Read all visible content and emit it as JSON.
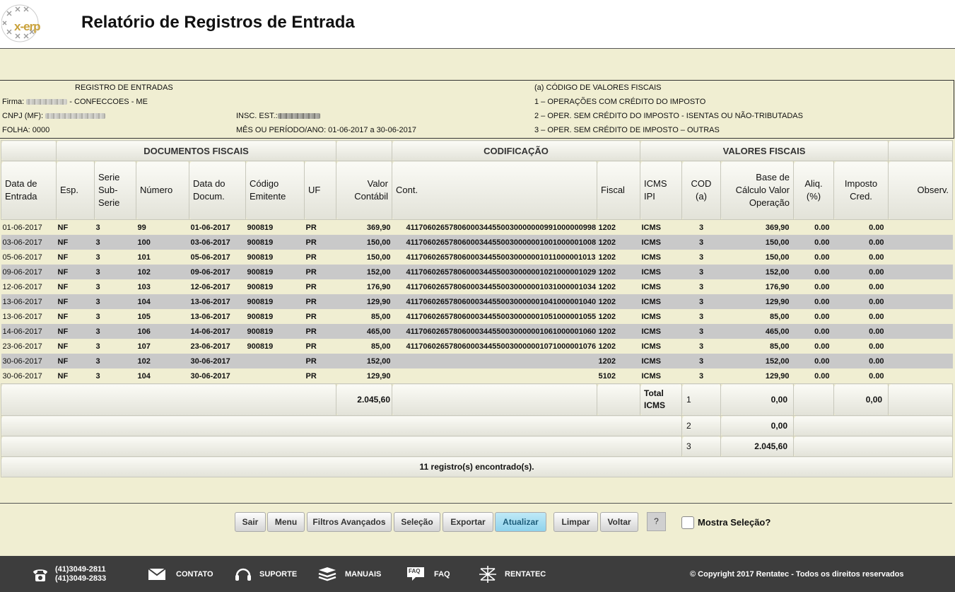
{
  "header": {
    "logo_text": "x-erp",
    "title": "Relatório de Registros de Entrada"
  },
  "info": {
    "registro_title": "REGISTRO DE ENTRADAS",
    "firma_label": "Firma:",
    "firma_suffix": "- CONFECCOES - ME",
    "cnpj_label": "CNPJ (MF):",
    "folha": "FOLHA: 0000",
    "insc_label": "INSC. EST.:",
    "periodo": "MÊS OU PERÍODO/ANO: 01-06-2017 a 30-06-2017",
    "codigo_title": "(a) CÓDIGO DE VALORES FISCAIS",
    "codigo_1": "1 – OPERAÇÕES COM CRÉDITO DO IMPOSTO",
    "codigo_2": "2 – OPER. SEM CRÉDITO DO IMPOSTO - ISENTAS OU NÃO-TRIBUTADAS",
    "codigo_3": "3 – OPER. SEM CRÉDITO DE IMPOSTO – OUTRAS"
  },
  "groups": {
    "documentos": "DOCUMENTOS FISCAIS",
    "codificacao": "CODIFICAÇÃO",
    "valores": "VALORES FISCAIS"
  },
  "columns": [
    "Data de Entrada",
    "Esp.",
    "Serie Sub-Serie",
    "Número",
    "Data do Docum.",
    "Código Emitente",
    "UF",
    "Valor Contábil",
    "Cont.",
    "Fiscal",
    "ICMS IPI",
    "COD (a)",
    "Base de Cálculo Valor Operação",
    "Aliq. (%)",
    "Imposto Cred.",
    "Observ."
  ],
  "rows": [
    [
      "01-06-2017",
      "NF",
      "3",
      "99",
      "01-06-2017",
      "900819",
      "PR",
      "369,90",
      "41170602657806000344550030000000991000000998",
      "1202",
      "ICMS",
      "3",
      "369,90",
      "0.00",
      "0.00",
      ""
    ],
    [
      "03-06-2017",
      "NF",
      "3",
      "100",
      "03-06-2017",
      "900819",
      "PR",
      "150,00",
      "41170602657806000344550030000001001000001008",
      "1202",
      "ICMS",
      "3",
      "150,00",
      "0.00",
      "0.00",
      ""
    ],
    [
      "05-06-2017",
      "NF",
      "3",
      "101",
      "05-06-2017",
      "900819",
      "PR",
      "150,00",
      "41170602657806000344550030000001011000001013",
      "1202",
      "ICMS",
      "3",
      "150,00",
      "0.00",
      "0.00",
      ""
    ],
    [
      "09-06-2017",
      "NF",
      "3",
      "102",
      "09-06-2017",
      "900819",
      "PR",
      "152,00",
      "41170602657806000344550030000001021000001029",
      "1202",
      "ICMS",
      "3",
      "152,00",
      "0.00",
      "0.00",
      ""
    ],
    [
      "12-06-2017",
      "NF",
      "3",
      "103",
      "12-06-2017",
      "900819",
      "PR",
      "176,90",
      "41170602657806000344550030000001031000001034",
      "1202",
      "ICMS",
      "3",
      "176,90",
      "0.00",
      "0.00",
      ""
    ],
    [
      "13-06-2017",
      "NF",
      "3",
      "104",
      "13-06-2017",
      "900819",
      "PR",
      "129,90",
      "41170602657806000344550030000001041000001040",
      "1202",
      "ICMS",
      "3",
      "129,90",
      "0.00",
      "0.00",
      ""
    ],
    [
      "13-06-2017",
      "NF",
      "3",
      "105",
      "13-06-2017",
      "900819",
      "PR",
      "85,00",
      "41170602657806000344550030000001051000001055",
      "1202",
      "ICMS",
      "3",
      "85,00",
      "0.00",
      "0.00",
      ""
    ],
    [
      "14-06-2017",
      "NF",
      "3",
      "106",
      "14-06-2017",
      "900819",
      "PR",
      "465,00",
      "41170602657806000344550030000001061000001060",
      "1202",
      "ICMS",
      "3",
      "465,00",
      "0.00",
      "0.00",
      ""
    ],
    [
      "23-06-2017",
      "NF",
      "3",
      "107",
      "23-06-2017",
      "900819",
      "PR",
      "85,00",
      "41170602657806000344550030000001071000001076",
      "1202",
      "ICMS",
      "3",
      "85,00",
      "0.00",
      "0.00",
      ""
    ],
    [
      "30-06-2017",
      "NF",
      "3",
      "102",
      "30-06-2017",
      "",
      "PR",
      "152,00",
      "",
      "1202",
      "ICMS",
      "3",
      "152,00",
      "0.00",
      "0.00",
      ""
    ],
    [
      "30-06-2017",
      "NF",
      "3",
      "104",
      "30-06-2017",
      "",
      "PR",
      "129,90",
      "",
      "5102",
      "ICMS",
      "3",
      "129,90",
      "0.00",
      "0.00",
      ""
    ]
  ],
  "totals": {
    "valor_contabil": "2.045,60",
    "label": "Total ICMS",
    "cod1": "1",
    "base1": "0,00",
    "imposto1": "0,00",
    "cod2": "2",
    "base2": "0,00",
    "cod3": "3",
    "base3": "2.045,60",
    "record_count": "11 registro(s) encontrado(s)."
  },
  "buttons": [
    "Sair",
    "Menu",
    "Filtros Avançados",
    "Seleção",
    "Exportar",
    "Atualizar",
    "Limpar",
    "Voltar"
  ],
  "help_button": "?",
  "mostra_selecao": "Mostra Seleção?",
  "footer": {
    "phone1": "(41)3049-2811",
    "phone2": "(41)3049-2833",
    "contato": "CONTATO",
    "suporte": "SUPORTE",
    "manuais": "MANUAIS",
    "faq": "FAQ",
    "faq_icon_text": "FAQ",
    "rentatec": "RENTATEC",
    "copyright": "© Copyright 2017 Rentatec - Todos os direitos reservados"
  },
  "colors": {
    "background": "#f0eed2",
    "footer": "#3d3d3d",
    "active_button": "#a6dcef",
    "alt_row": "#c9c9c9"
  }
}
